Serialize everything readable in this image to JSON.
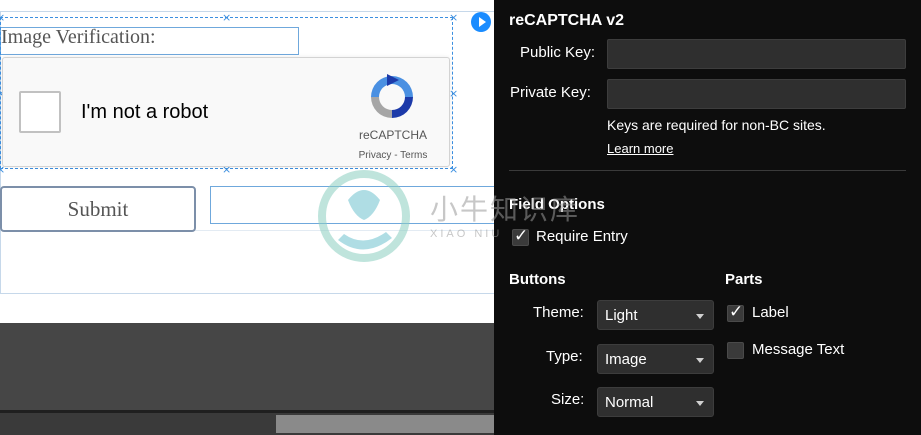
{
  "canvas": {
    "field_label": "Image Verification:",
    "recaptcha": {
      "checkbox_text": "I'm not a robot",
      "brand": "reCAPTCHA",
      "links": "Privacy - Terms"
    },
    "submit_label": "Submit"
  },
  "panel": {
    "title": "reCAPTCHA v2",
    "public_key_label": "Public Key:",
    "public_key_value": "",
    "private_key_label": "Private Key:",
    "private_key_value": "",
    "keys_note": "Keys are required for non-BC sites.",
    "learn_more": "Learn more",
    "field_options": {
      "heading": "Field Options",
      "require_entry_label": "Require Entry",
      "require_entry_checked": true
    },
    "buttons": {
      "heading": "Buttons",
      "theme_label": "Theme:",
      "theme_value": "Light",
      "type_label": "Type:",
      "type_value": "Image",
      "size_label": "Size:",
      "size_value": "Normal"
    },
    "parts": {
      "heading": "Parts",
      "label_label": "Label",
      "label_checked": true,
      "message_text_label": "Message Text",
      "message_text_checked": false
    }
  },
  "watermark": {
    "text": "小牛知识库",
    "sub": "XIAO NIU"
  },
  "colors": {
    "panel_bg": "#0d0d0d",
    "accent_blue": "#1a8cff",
    "selection_blue": "#3b8fe0"
  }
}
